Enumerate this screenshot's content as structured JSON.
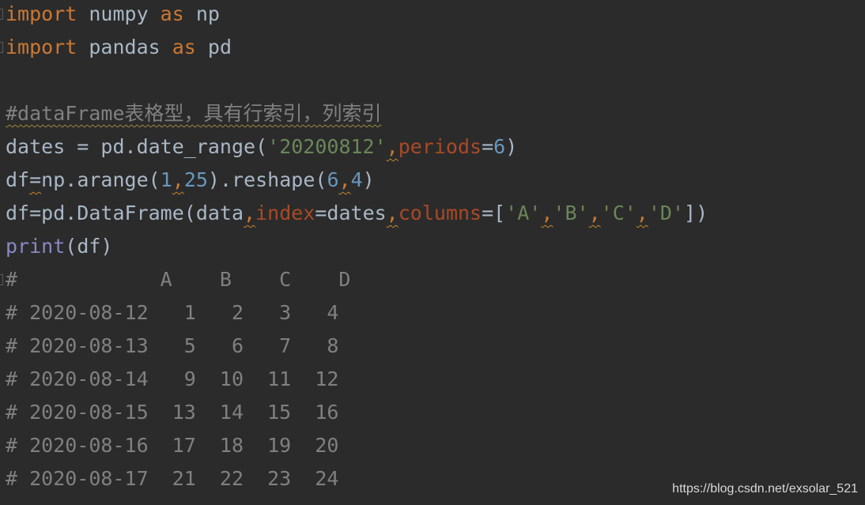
{
  "code": {
    "l1": {
      "k1": "import",
      "t1": " numpy ",
      "k2": "as",
      "t2": " np"
    },
    "l2": {
      "k1": "import",
      "t1": " pandas ",
      "k2": "as",
      "t2": " pd"
    },
    "l4": {
      "comment": "#dataFrame表格型，具有行索引，列索引"
    },
    "l5": {
      "a": "dates = pd.date_range(",
      "s": "'20200812'",
      "c": ",",
      "p": "periods",
      "e": "=",
      "n": "6",
      "z": ")"
    },
    "l6": {
      "a": "df",
      "e": "=",
      "b": "np.arange(",
      "n1": "1",
      "c1": ",",
      "n2": "25",
      "d": ").reshape(",
      "n3": "6",
      "c2": ",",
      "n4": "4",
      "z": ")"
    },
    "l7": {
      "a": "df=pd.DataFrame(data",
      "c1": ",",
      "p1": "index",
      "e1": "=dates",
      "c2": ",",
      "p2": "columns",
      "e2": "=[",
      "s1": "'A'",
      "c3": ",",
      "s2": "'B'",
      "c4": ",",
      "s3": "'C'",
      "c5": ",",
      "s4": "'D'",
      "z": "])"
    },
    "l8": {
      "f": "print",
      "a": "(df)"
    },
    "out_header": "#            A    B    C    D",
    "out_rows": [
      "# 2020-08-12   1   2   3   4",
      "# 2020-08-13   5   6   7   8",
      "# 2020-08-14   9  10  11  12",
      "# 2020-08-15  13  14  15  16",
      "# 2020-08-16  17  18  19  20",
      "# 2020-08-17  21  22  23  24"
    ]
  },
  "watermark": "https://blog.csdn.net/exsolar_521"
}
